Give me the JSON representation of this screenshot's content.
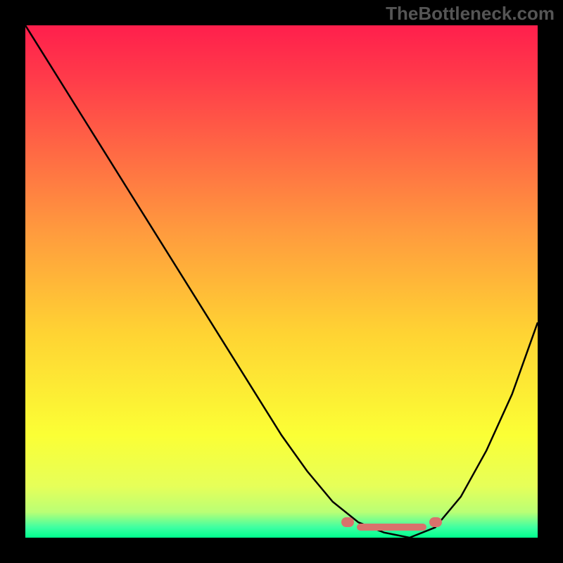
{
  "watermark": "TheBottleneck.com",
  "chart_data": {
    "type": "line",
    "title": "",
    "xlabel": "",
    "ylabel": "",
    "xlim": [
      0,
      100
    ],
    "ylim": [
      0,
      100
    ],
    "x": [
      0,
      5,
      10,
      15,
      20,
      25,
      30,
      35,
      40,
      45,
      50,
      55,
      60,
      65,
      70,
      75,
      80,
      85,
      90,
      95,
      100
    ],
    "values": [
      100,
      92,
      84,
      76,
      68,
      60,
      52,
      44,
      36,
      28,
      20,
      13,
      7,
      3,
      1,
      0,
      2,
      8,
      17,
      28,
      42
    ],
    "optimum_zone": {
      "x_start": 63,
      "x_end": 80,
      "y": 3
    }
  }
}
